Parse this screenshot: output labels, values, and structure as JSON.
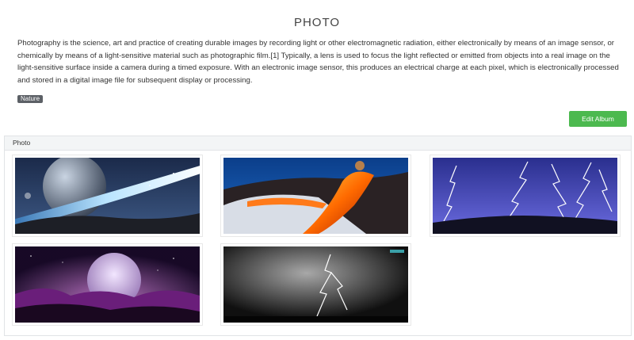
{
  "album": {
    "title": "PHOTO",
    "description": "Photography is the science, art and practice of creating durable images by recording light or other electromagnetic radiation, either electronically by means of an image sensor, or chemically by means of a light-sensitive material such as photographic film.[1] Typically, a lens is used to focus the light reflected or emitted from objects into a real image on the light-sensitive surface inside a camera during a timed exposure. With an electronic image sensor, this produces an electrical charge at each pixel, which is electronically processed and stored in a digital image file for subsequent display or processing.",
    "tag": "Nature",
    "edit_button": "Edit Album"
  },
  "panel": {
    "heading": "Photo"
  },
  "colors": {
    "edit_button": "#4cb94f",
    "tag": "#5c6066",
    "panel_heading": "#f3f5f6"
  },
  "photos": [
    {
      "subject": "planet-horizon"
    },
    {
      "subject": "lava-flow"
    },
    {
      "subject": "lightning-storm"
    },
    {
      "subject": "purple-moon"
    },
    {
      "subject": "monochrome-lightning"
    }
  ]
}
